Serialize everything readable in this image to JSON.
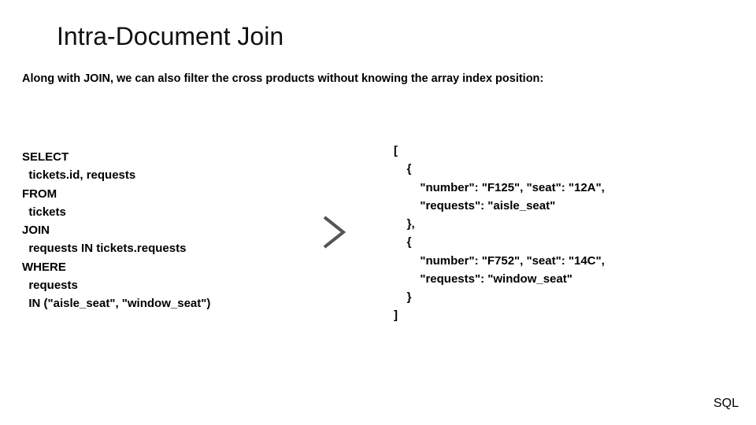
{
  "title": "Intra-Document Join",
  "subtitle": "Along with JOIN, we can also filter the cross products without knowing the array index position:",
  "sql_code": "SELECT\n  tickets.id, requests\nFROM\n  tickets\nJOIN\n  requests IN tickets.requests\nWHERE\n  requests\n  IN (\"aisle_seat\", \"window_seat\")",
  "json_output": "[\n    {\n        \"number\": \"F125\", \"seat\": \"12A\",\n        \"requests\": \"aisle_seat\"\n    },\n    {\n        \"number\": \"F752\", \"seat\": \"14C\",\n        \"requests\": \"window_seat\"\n    }\n]",
  "footer": "SQL"
}
